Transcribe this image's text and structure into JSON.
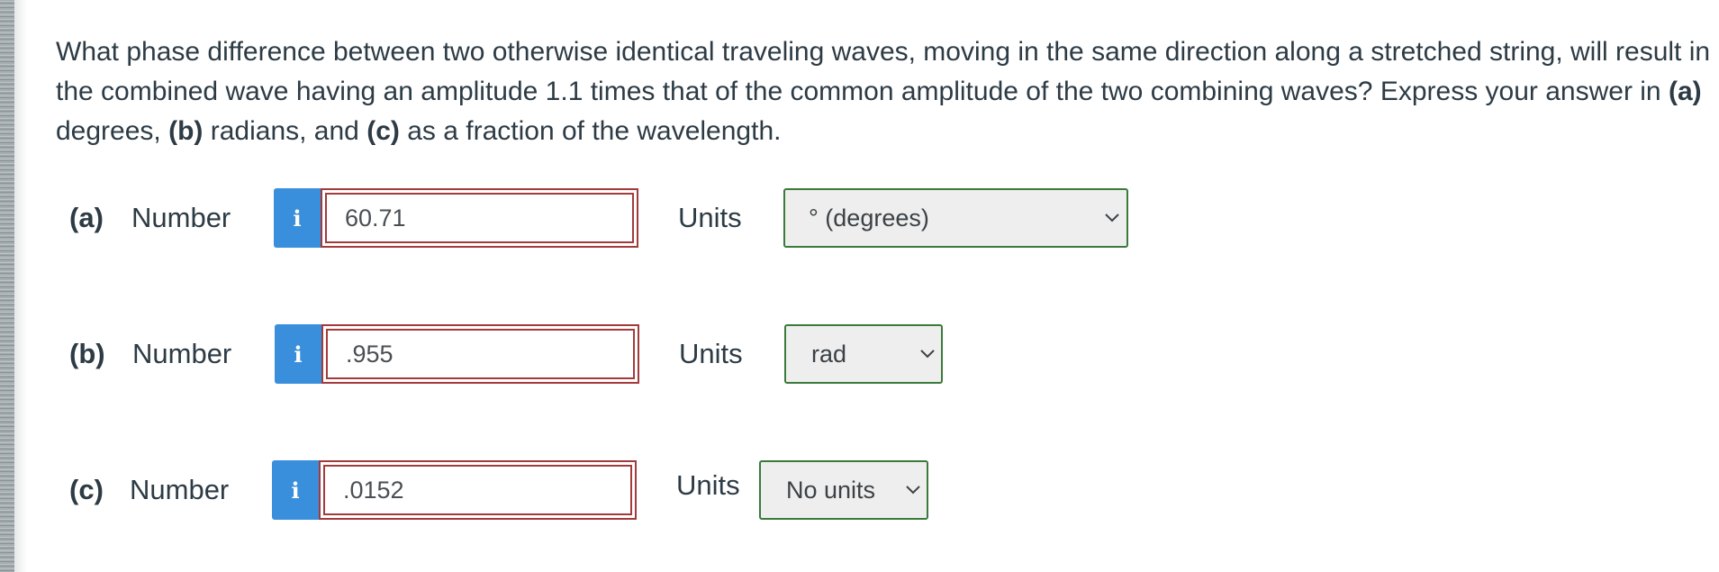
{
  "question": {
    "text_1": "What phase difference between two otherwise identical traveling waves, moving in the same direction along a stretched string, will result in the combined wave having an amplitude 1.1 times that of the common amplitude of the two combining waves? Express your answer in ",
    "a": "(a)",
    "text_2": " degrees, ",
    "b": "(b)",
    "text_3": " radians, and ",
    "c": "(c)",
    "text_4": " as a fraction of the wavelength."
  },
  "parts": [
    {
      "label": "(a)",
      "number_label": "Number",
      "info": "i",
      "value": "60.71",
      "units_label": "Units",
      "unit": "° (degrees)"
    },
    {
      "label": "(b)",
      "number_label": "Number",
      "info": "i",
      "value": ".955",
      "units_label": "Units",
      "unit": "rad"
    },
    {
      "label": "(c)",
      "number_label": "Number",
      "info": "i",
      "value": ".0152",
      "units_label": "Units",
      "unit": "No units"
    }
  ],
  "colors": {
    "info_button": "#3a8fdc",
    "input_border_incorrect": "#a23b3b",
    "select_border": "#3a7a3a"
  }
}
